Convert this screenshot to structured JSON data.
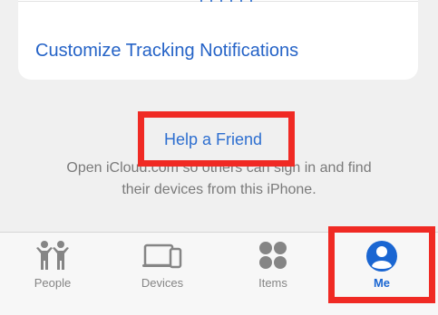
{
  "card": {
    "customize_link": "Customize Tracking Notifications"
  },
  "help": {
    "link_label": "Help a Friend",
    "description_line1": "Open iCloud.com so others can sign in and find",
    "description_line2": "their devices from this iPhone."
  },
  "tabs": [
    {
      "label": "People",
      "icon": "people-icon"
    },
    {
      "label": "Devices",
      "icon": "devices-icon"
    },
    {
      "label": "Items",
      "icon": "items-icon"
    },
    {
      "label": "Me",
      "icon": "me-icon",
      "selected": true
    }
  ],
  "colors": {
    "accent": "#1a66d2",
    "link": "#2563c7",
    "highlight": "#f02a24",
    "inactive": "#858585"
  }
}
